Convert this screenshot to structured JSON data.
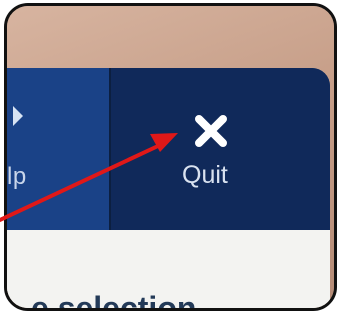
{
  "toolbar": {
    "help_label": "lp",
    "quit_label": "Quit"
  },
  "content": {
    "partial_text": "e selection"
  },
  "icons": [
    "close-icon",
    "help-arrow-icon",
    "red-arrow-annotation"
  ],
  "colors": {
    "toolbar_bg": "#0f2a55",
    "help_bg": "#1a4287",
    "quit_bg": "#10295a",
    "annotation": "#e01818"
  }
}
